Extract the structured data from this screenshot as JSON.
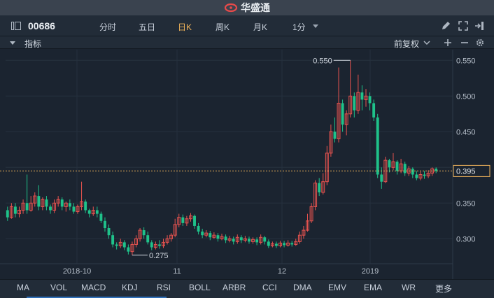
{
  "app": {
    "brand": "华盛通"
  },
  "toolbar": {
    "code": "00686",
    "tabs": [
      {
        "label": "分时",
        "active": false
      },
      {
        "label": "五日",
        "active": false
      },
      {
        "label": "日K",
        "active": true
      },
      {
        "label": "周K",
        "active": false
      },
      {
        "label": "月K",
        "active": false
      },
      {
        "label": "1分",
        "active": false
      }
    ]
  },
  "indicator_bar": {
    "label": "指标",
    "adjust": "前复权"
  },
  "bottom_bar": {
    "indicators": [
      "MA",
      "VOL",
      "MACD",
      "KDJ",
      "RSI",
      "BOLL",
      "ARBR",
      "CCI",
      "DMA",
      "EMV",
      "EMA",
      "WR",
      "更多"
    ]
  },
  "colors": {
    "up": "#e8534f",
    "down": "#1fc28a",
    "accent": "#f0b35a",
    "background": "#1b2430"
  },
  "chart_data": {
    "type": "candlestick",
    "title": "",
    "ylim": [
      0.265,
      0.565
    ],
    "y_ticks": [
      "0.550",
      "0.500",
      "0.450",
      "0.400",
      "0.350",
      "0.300"
    ],
    "x_ticks": [
      "2018-10",
      "11",
      "12",
      "2019"
    ],
    "current_price": "0.395",
    "high_annotation": "0.550",
    "low_annotation": "0.275",
    "candles": [
      [
        0.34,
        0.33,
        0.345,
        0.325
      ],
      [
        0.33,
        0.345,
        0.35,
        0.328
      ],
      [
        0.345,
        0.335,
        0.35,
        0.33
      ],
      [
        0.335,
        0.34,
        0.345,
        0.33
      ],
      [
        0.34,
        0.35,
        0.355,
        0.335
      ],
      [
        0.35,
        0.34,
        0.39,
        0.335
      ],
      [
        0.34,
        0.35,
        0.36,
        0.338
      ],
      [
        0.35,
        0.36,
        0.365,
        0.345
      ],
      [
        0.36,
        0.345,
        0.375,
        0.34
      ],
      [
        0.345,
        0.355,
        0.358,
        0.34
      ],
      [
        0.355,
        0.345,
        0.36,
        0.34
      ],
      [
        0.345,
        0.34,
        0.348,
        0.335
      ],
      [
        0.34,
        0.35,
        0.355,
        0.336
      ],
      [
        0.35,
        0.355,
        0.36,
        0.345
      ],
      [
        0.355,
        0.345,
        0.358,
        0.34
      ],
      [
        0.345,
        0.35,
        0.352,
        0.338
      ],
      [
        0.35,
        0.345,
        0.355,
        0.34
      ],
      [
        0.345,
        0.338,
        0.35,
        0.335
      ],
      [
        0.338,
        0.345,
        0.348,
        0.335
      ],
      [
        0.345,
        0.352,
        0.38,
        0.34
      ],
      [
        0.352,
        0.34,
        0.355,
        0.336
      ],
      [
        0.34,
        0.335,
        0.342,
        0.33
      ],
      [
        0.335,
        0.34,
        0.345,
        0.332
      ],
      [
        0.34,
        0.335,
        0.345,
        0.33
      ],
      [
        0.335,
        0.325,
        0.338,
        0.322
      ],
      [
        0.325,
        0.315,
        0.33,
        0.31
      ],
      [
        0.315,
        0.305,
        0.32,
        0.3
      ],
      [
        0.305,
        0.292,
        0.31,
        0.288
      ],
      [
        0.292,
        0.29,
        0.295,
        0.285
      ],
      [
        0.29,
        0.295,
        0.3,
        0.287
      ],
      [
        0.295,
        0.288,
        0.298,
        0.284
      ],
      [
        0.288,
        0.282,
        0.292,
        0.278
      ],
      [
        0.282,
        0.292,
        0.296,
        0.277
      ],
      [
        0.292,
        0.3,
        0.305,
        0.288
      ],
      [
        0.3,
        0.312,
        0.315,
        0.296
      ],
      [
        0.312,
        0.305,
        0.316,
        0.3
      ],
      [
        0.305,
        0.295,
        0.31,
        0.292
      ],
      [
        0.295,
        0.288,
        0.298,
        0.284
      ],
      [
        0.288,
        0.292,
        0.296,
        0.285
      ],
      [
        0.292,
        0.29,
        0.298,
        0.286
      ],
      [
        0.29,
        0.295,
        0.3,
        0.287
      ],
      [
        0.295,
        0.3,
        0.305,
        0.292
      ],
      [
        0.3,
        0.305,
        0.308,
        0.296
      ],
      [
        0.305,
        0.32,
        0.328,
        0.302
      ],
      [
        0.32,
        0.33,
        0.335,
        0.316
      ],
      [
        0.33,
        0.322,
        0.334,
        0.318
      ],
      [
        0.322,
        0.328,
        0.332,
        0.318
      ],
      [
        0.328,
        0.332,
        0.336,
        0.324
      ],
      [
        0.332,
        0.318,
        0.334,
        0.314
      ],
      [
        0.318,
        0.31,
        0.322,
        0.306
      ],
      [
        0.31,
        0.305,
        0.314,
        0.301
      ],
      [
        0.305,
        0.308,
        0.312,
        0.302
      ],
      [
        0.308,
        0.302,
        0.311,
        0.298
      ],
      [
        0.302,
        0.305,
        0.309,
        0.3
      ],
      [
        0.305,
        0.3,
        0.308,
        0.296
      ],
      [
        0.3,
        0.303,
        0.307,
        0.298
      ],
      [
        0.303,
        0.298,
        0.306,
        0.294
      ],
      [
        0.298,
        0.3,
        0.304,
        0.295
      ],
      [
        0.3,
        0.296,
        0.303,
        0.292
      ],
      [
        0.296,
        0.302,
        0.306,
        0.293
      ],
      [
        0.302,
        0.298,
        0.305,
        0.294
      ],
      [
        0.298,
        0.3,
        0.304,
        0.295
      ],
      [
        0.3,
        0.296,
        0.303,
        0.293
      ],
      [
        0.296,
        0.299,
        0.302,
        0.293
      ],
      [
        0.299,
        0.295,
        0.302,
        0.291
      ],
      [
        0.295,
        0.302,
        0.306,
        0.292
      ],
      [
        0.302,
        0.296,
        0.304,
        0.292
      ],
      [
        0.296,
        0.29,
        0.299,
        0.287
      ],
      [
        0.29,
        0.293,
        0.296,
        0.288
      ],
      [
        0.293,
        0.29,
        0.296,
        0.287
      ],
      [
        0.29,
        0.294,
        0.297,
        0.288
      ],
      [
        0.294,
        0.291,
        0.297,
        0.288
      ],
      [
        0.291,
        0.294,
        0.298,
        0.289
      ],
      [
        0.294,
        0.292,
        0.297,
        0.289
      ],
      [
        0.292,
        0.296,
        0.3,
        0.29
      ],
      [
        0.296,
        0.305,
        0.31,
        0.293
      ],
      [
        0.305,
        0.312,
        0.318,
        0.3
      ],
      [
        0.312,
        0.325,
        0.335,
        0.31
      ],
      [
        0.325,
        0.345,
        0.35,
        0.322
      ],
      [
        0.345,
        0.378,
        0.382,
        0.34
      ],
      [
        0.378,
        0.365,
        0.385,
        0.36
      ],
      [
        0.365,
        0.38,
        0.392,
        0.362
      ],
      [
        0.38,
        0.42,
        0.43,
        0.375
      ],
      [
        0.42,
        0.45,
        0.46,
        0.415
      ],
      [
        0.45,
        0.44,
        0.47,
        0.435
      ],
      [
        0.44,
        0.49,
        0.54,
        0.435
      ],
      [
        0.49,
        0.46,
        0.495,
        0.45
      ],
      [
        0.46,
        0.475,
        0.48,
        0.445
      ],
      [
        0.475,
        0.5,
        0.55,
        0.47
      ],
      [
        0.5,
        0.48,
        0.505,
        0.47
      ],
      [
        0.48,
        0.505,
        0.53,
        0.475
      ],
      [
        0.505,
        0.495,
        0.515,
        0.48
      ],
      [
        0.495,
        0.5,
        0.51,
        0.485
      ],
      [
        0.5,
        0.49,
        0.505,
        0.48
      ],
      [
        0.49,
        0.47,
        0.495,
        0.465
      ],
      [
        0.47,
        0.39,
        0.475,
        0.385
      ],
      [
        0.39,
        0.38,
        0.4,
        0.37
      ],
      [
        0.38,
        0.41,
        0.415,
        0.378
      ],
      [
        0.41,
        0.4,
        0.412,
        0.393
      ],
      [
        0.4,
        0.408,
        0.42,
        0.396
      ],
      [
        0.408,
        0.395,
        0.41,
        0.39
      ],
      [
        0.395,
        0.405,
        0.412,
        0.392
      ],
      [
        0.405,
        0.392,
        0.408,
        0.388
      ],
      [
        0.392,
        0.398,
        0.402,
        0.388
      ],
      [
        0.398,
        0.39,
        0.4,
        0.385
      ],
      [
        0.39,
        0.385,
        0.395,
        0.382
      ],
      [
        0.385,
        0.39,
        0.394,
        0.382
      ],
      [
        0.39,
        0.388,
        0.395,
        0.384
      ],
      [
        0.388,
        0.392,
        0.396,
        0.385
      ],
      [
        0.392,
        0.398,
        0.4,
        0.388
      ],
      [
        0.398,
        0.395,
        0.4,
        0.392
      ]
    ]
  }
}
